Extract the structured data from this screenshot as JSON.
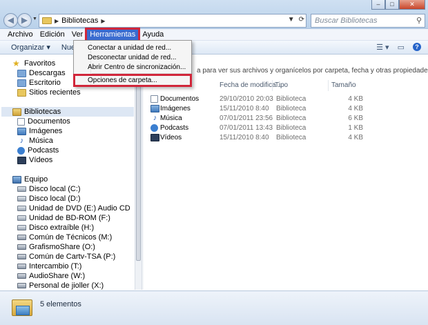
{
  "window": {
    "controls": [
      "–",
      "□",
      "✕"
    ],
    "address": {
      "crumb": "Bibliotecas"
    },
    "search_placeholder": "Buscar Bibliotecas"
  },
  "menubar": {
    "items": [
      "Archivo",
      "Edición",
      "Ver",
      "Herramientas",
      "Ayuda"
    ],
    "active": "Herramientas"
  },
  "toolbar": {
    "organize": "Organizar",
    "new": "Nueva"
  },
  "tools_menu": {
    "items": [
      "Conectar a unidad de red...",
      "Desconectar unidad de red...",
      "Abrir Centro de sincronización...",
      "Opciones de carpeta..."
    ],
    "highlighted": "Opciones de carpeta..."
  },
  "navigation": {
    "favorites": {
      "header": "Favoritos",
      "items": [
        "Descargas",
        "Escritorio",
        "Sitios recientes"
      ]
    },
    "libraries": {
      "header": "Bibliotecas",
      "items": [
        "Documentos",
        "Imágenes",
        "Música",
        "Podcasts",
        "Vídeos"
      ]
    },
    "computer": {
      "header": "Equipo",
      "items": [
        "Disco local (C:)",
        "Disco local (D:)",
        "Unidad de DVD (E:) Audio CD",
        "Unidad de BD-ROM (F:)",
        "Disco extraíble (H:)",
        "Común de Técnicos (M:)",
        "GrafismoShare (O:)",
        "Común de Cartv-TSA (P:)",
        "Intercambio (T:)",
        "AudioShare (W:)",
        "Personal de jioller (X:)"
      ]
    }
  },
  "content": {
    "description": "a para ver sus archivos y organícelos por carpeta, fecha y otras propiedades.",
    "columns": [
      "Fecha de modifica...",
      "Tipo",
      "Tamaño"
    ],
    "rows": [
      {
        "name": "Documentos",
        "date": "29/10/2010 20:03",
        "type": "Biblioteca",
        "size": "4 KB"
      },
      {
        "name": "Imágenes",
        "date": "15/11/2010 8:40",
        "type": "Biblioteca",
        "size": "4 KB"
      },
      {
        "name": "Música",
        "date": "07/01/2011 23:56",
        "type": "Biblioteca",
        "size": "6 KB"
      },
      {
        "name": "Podcasts",
        "date": "07/01/2011 13:43",
        "type": "Biblioteca",
        "size": "1 KB"
      },
      {
        "name": "Vídeos",
        "date": "15/11/2010 8:40",
        "type": "Biblioteca",
        "size": "4 KB"
      }
    ]
  },
  "details": {
    "count": "5 elementos"
  }
}
